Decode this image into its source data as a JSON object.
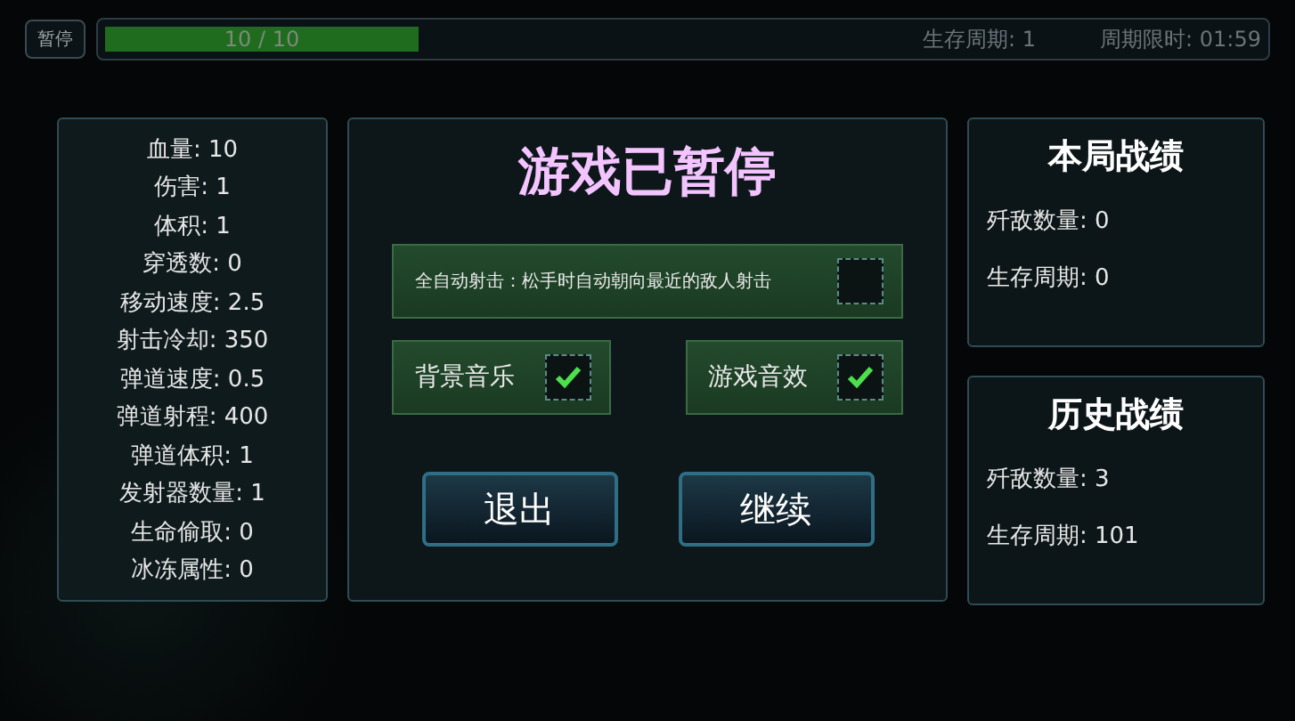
{
  "top_bar": {
    "pause_button": "暂停",
    "hp": {
      "text": "10 / 10"
    },
    "survival_cycle": "生存周期:  1",
    "cycle_time_limit": "周期限时: 01:59"
  },
  "stats": [
    "血量: 10",
    "伤害: 1",
    "体积: 1",
    "穿透数: 0",
    "移动速度: 2.5",
    "射击冷却: 350",
    "弹道速度: 0.5",
    "弹道射程: 400",
    "弹道体积: 1",
    "发射器数量: 1",
    "生命偷取: 0",
    "冰冻属性: 0"
  ],
  "pause_dialog": {
    "title": "游戏已暂停",
    "options": [
      {
        "label": "全自动射击：松手时自动朝向最近的敌人射击",
        "checked": false
      },
      {
        "label": "背景音乐",
        "checked": true
      },
      {
        "label": "游戏音效",
        "checked": true
      }
    ],
    "buttons": [
      "退出",
      "继续"
    ]
  },
  "records": [
    {
      "title": "本局战绩",
      "lines": [
        "歼敌数量: 0",
        "生存周期: 0"
      ]
    },
    {
      "title": "历史战绩",
      "lines": [
        "歼敌数量: 3",
        "生存周期: 101"
      ]
    }
  ]
}
